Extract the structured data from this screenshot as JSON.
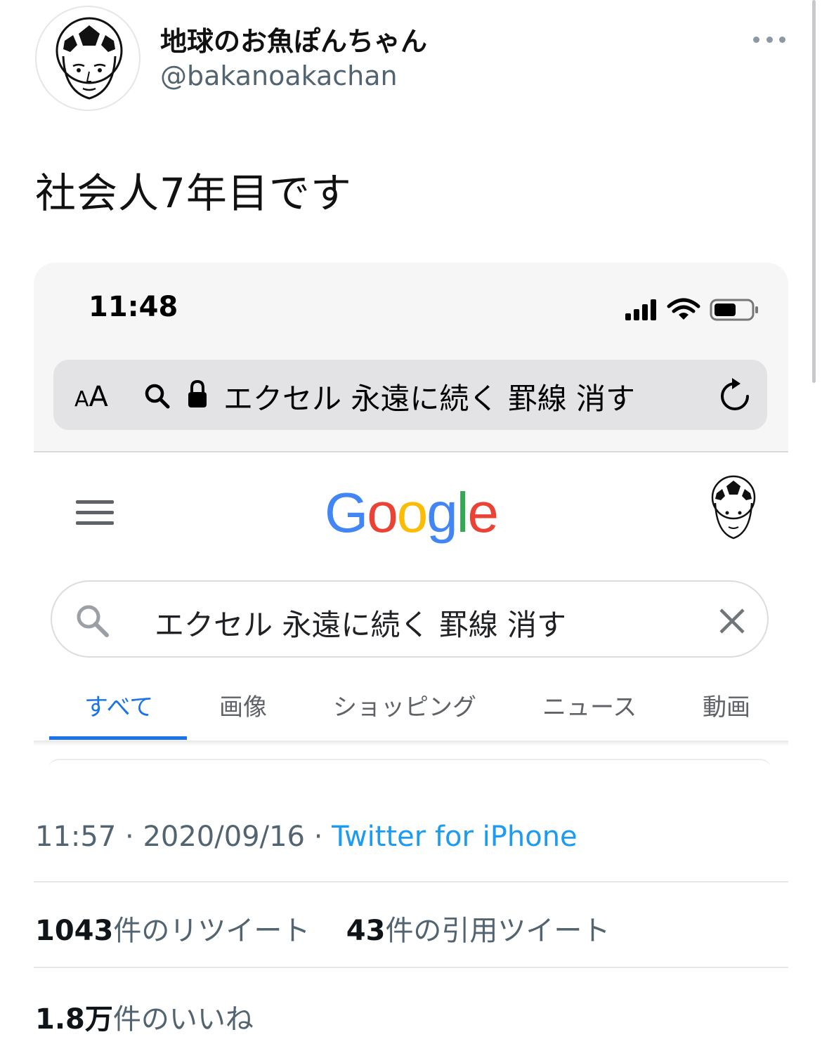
{
  "user": {
    "display_name": "地球のお魚ぽんちゃん",
    "handle": "@bakanoakachan"
  },
  "tweet": {
    "text": "社会人7年目です",
    "time": "11:57",
    "date": "2020/09/16",
    "source": "Twitter for iPhone",
    "separator": " · "
  },
  "stats": {
    "retweets_count": "1043",
    "retweets_label": "件のリツイート",
    "quotes_count": "43",
    "quotes_label": "件の引用ツイート",
    "likes_count": "1.8万",
    "likes_label": "件のいいね"
  },
  "screenshot": {
    "status_time": "11:48",
    "reader_large": "A",
    "reader_small": "A",
    "url_text": "エクセル 永遠に続く 罫線 消す",
    "search_query": "エクセル 永遠に続く 罫線 消す",
    "logo_letters": [
      "G",
      "o",
      "o",
      "g",
      "l",
      "e"
    ],
    "logo_colors": [
      "#4285F4",
      "#EA4335",
      "#FBBC05",
      "#4285F4",
      "#34A853",
      "#EA4335"
    ],
    "tabs": [
      {
        "label": "すべて",
        "active": true
      },
      {
        "label": "画像",
        "active": false
      },
      {
        "label": "ショッピング",
        "active": false
      },
      {
        "label": "ニュース",
        "active": false
      },
      {
        "label": "動画",
        "active": false
      }
    ]
  },
  "icons": [
    "more-icon",
    "signal-icon",
    "wifi-icon",
    "battery-icon",
    "search-icon",
    "lock-icon",
    "reload-icon",
    "menu-icon",
    "clear-icon"
  ],
  "colors": {
    "link_blue": "#1d9bf0",
    "google_tab_active": "#1a73e8",
    "meta_gray": "#536471"
  }
}
